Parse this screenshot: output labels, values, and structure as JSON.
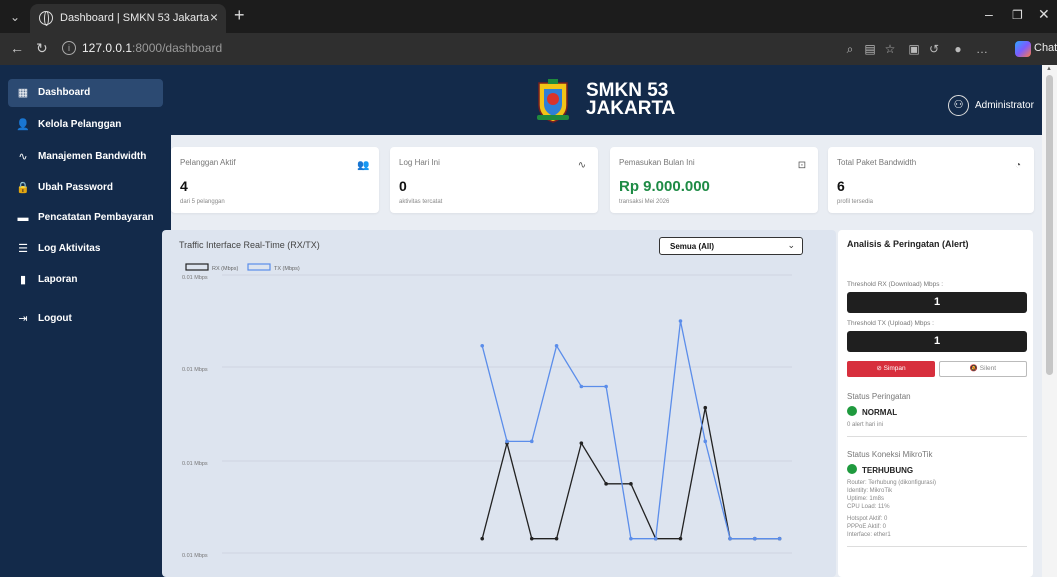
{
  "browser": {
    "tab_title": "Dashboard | SMKN 53 Jakarta",
    "url_host": "127.0.0.1",
    "url_rest": ":8000/dashboard",
    "chat_label": "Chat"
  },
  "sidebar": {
    "items": [
      {
        "label": "Dashboard",
        "icon": "grid-icon"
      },
      {
        "label": "Kelola Pelanggan",
        "icon": "user-icon"
      },
      {
        "label": "Manajemen Bandwidth",
        "icon": "pulse-icon"
      },
      {
        "label": "Ubah Password",
        "icon": "lock-icon"
      },
      {
        "label": "Pencatatan Pembayaran",
        "icon": "wallet-icon"
      },
      {
        "label": "Log Aktivitas",
        "icon": "list-icon"
      },
      {
        "label": "Laporan",
        "icon": "document-icon"
      },
      {
        "label": "Logout",
        "icon": "logout-icon"
      }
    ]
  },
  "header": {
    "brand_line1": "SMKN 53",
    "brand_line2": "JAKARTA",
    "user_name": "Administrator"
  },
  "cards": [
    {
      "label": "Pelanggan Aktif",
      "value": "4",
      "sub": "dari 5 pelanggan",
      "icon": "users-icon"
    },
    {
      "label": "Log Hari Ini",
      "value": "0",
      "sub": "aktivitas tercatat",
      "icon": "activity-icon"
    },
    {
      "label": "Pemasukan Bulan Ini",
      "value": "Rp 9.000.000",
      "sub": "transaksi Mei 2026",
      "icon": "cash-icon"
    },
    {
      "label": "Total Paket Bandwidth",
      "value": "6",
      "sub": "profil tersedia",
      "icon": "speedometer-icon"
    }
  ],
  "traffic": {
    "title": "Traffic Interface Real-Time (RX/TX)",
    "select_value": "Semua (All)"
  },
  "chart_data": {
    "type": "line",
    "legend_placement": "top-left",
    "series": [
      {
        "name": "RX (Mbps)",
        "color": "#222222",
        "values": [
          null,
          null,
          null,
          null,
          null,
          null,
          null,
          null,
          null,
          null,
          0.0016,
          0.007,
          0.0016,
          0.0016,
          0.007,
          0.0047,
          0.0047,
          0.0016,
          0.0016,
          0.009,
          0.0016,
          0.0016,
          0.0016
        ]
      },
      {
        "name": "TX (Mbps)",
        "color": "#5b8dea",
        "values": [
          null,
          null,
          null,
          null,
          null,
          null,
          null,
          null,
          null,
          null,
          0.0125,
          0.0071,
          0.0071,
          0.0125,
          0.0102,
          0.0102,
          0.0016,
          0.0016,
          0.0139,
          0.0071,
          0.0016,
          0.0016,
          0.0016
        ]
      }
    ],
    "ytick_labels": [
      "0.01 Mbps",
      "0.01 Mbps",
      "0.01 Mbps",
      "0.01 Mbps"
    ],
    "grid": true
  },
  "alert": {
    "title": "Analisis & Peringatan (Alert)",
    "rx_label": "Threshold RX (Download) Mbps :",
    "rx_value": "1",
    "tx_label": "Threshold TX (Upload) Mbps :",
    "tx_value": "1",
    "save_label": "⊘ Simpan",
    "silent_label": "🔕 Silent",
    "status_title": "Status Peringatan",
    "status_value": "NORMAL",
    "status_sub": "0 alert hari ini",
    "mikrotik_title": "Status Koneksi MikroTik",
    "mikrotik_value": "TERHUBUNG",
    "router": "Router: Terhubung (dikonfigurasi)",
    "identity": "Identity: MikroTik",
    "uptime": "Uptime: 1m8s",
    "cpu": "CPU Load: 11%",
    "hotspot": "Hotspot Aktif: 0",
    "pppoe": "PPPoE Aktif: 0",
    "interface": "Interface: ether1",
    "status_color": "#1f9a3e"
  }
}
